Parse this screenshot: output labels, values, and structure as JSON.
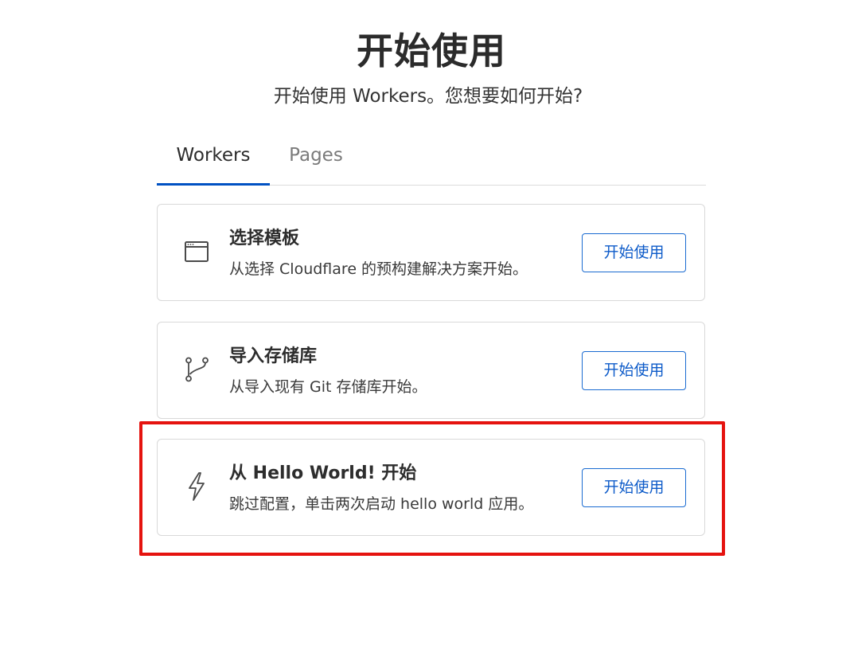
{
  "header": {
    "title": "开始使用",
    "subtitle": "开始使用 Workers。您想要如何开始?"
  },
  "tabs": [
    {
      "label": "Workers",
      "active": true
    },
    {
      "label": "Pages",
      "active": false
    }
  ],
  "cards": [
    {
      "icon": "browser-window-icon",
      "title": "选择模板",
      "description": "从选择 Cloudflare 的预构建解决方案开始。",
      "button_label": "开始使用"
    },
    {
      "icon": "git-branch-icon",
      "title": "导入存储库",
      "description": "从导入现有 Git 存储库开始。",
      "button_label": "开始使用"
    },
    {
      "icon": "lightning-bolt-icon",
      "title": "从 Hello World! 开始",
      "description": "跳过配置，单击两次启动 hello world 应用。",
      "button_label": "开始使用",
      "highlighted": true
    }
  ],
  "colors": {
    "accent": "#0051c3",
    "button_text": "#0d5bc9",
    "highlight": "#e5130f"
  }
}
